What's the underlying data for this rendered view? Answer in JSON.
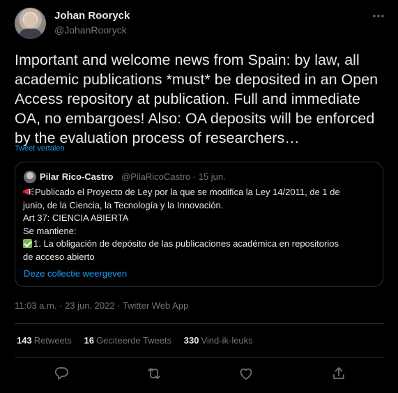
{
  "author": {
    "name": "Johan Rooryck",
    "handle": "@JohanRooryck"
  },
  "tweet": {
    "text": "Important and welcome news from Spain: by law, all academic publications *must* be deposited in an Open Access repository at publication. Full and immediate OA, no embargoes! Also: OA deposits will be enforced by the evaluation process of researchers…",
    "translate_label": "Tweet vertalen",
    "timestamp": "11:03 a.m. · 23 jun. 2022 · Twitter Web App"
  },
  "quoted": {
    "name": "Pilar Rico-Castro",
    "handle_date": "@PilaRicoCastro · 15 jun.",
    "line1": "Publicado el Proyecto de Ley por la que se modifica la Ley 14/2011, de 1 de",
    "line2": "junio, de la Ciencia, la Tecnología y la Innovación.",
    "line3": "Art 37: CIENCIA ABIERTA",
    "line4": "Se mantiene:",
    "line5": "1. La obligación de depósito de las publicaciones académica en repositorios",
    "line6": "de acceso abierto",
    "link": "Deze collectie weergeven"
  },
  "stats": {
    "retweets_count": "143",
    "retweets_label": "Retweets",
    "quotes_count": "16",
    "quotes_label": "Geciteerde Tweets",
    "likes_count": "330",
    "likes_label": "Vind-ik-leuks"
  },
  "icons": [
    "more-icon",
    "megaphone-icon",
    "check-icon",
    "reply-icon",
    "retweet-icon",
    "like-icon",
    "share-icon"
  ],
  "colors": {
    "background": "#000000",
    "text": "#e7e9ea",
    "muted": "#71767b",
    "accent": "#1d9bf0",
    "border": "#2f3336"
  }
}
